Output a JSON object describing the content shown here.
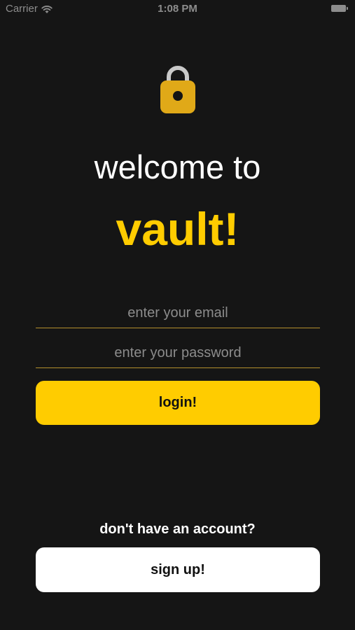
{
  "status_bar": {
    "carrier": "Carrier",
    "time": "1:08 PM",
    "wifi_icon": "wifi-icon",
    "battery_icon": "battery-icon"
  },
  "header": {
    "icon": "lock-icon",
    "welcome": "welcome to",
    "app_name": "vault!"
  },
  "form": {
    "email_placeholder": "enter your email",
    "email_value": "",
    "password_placeholder": "enter your password",
    "password_value": "",
    "login_label": "login!"
  },
  "footer": {
    "prompt": "don't have an account?",
    "signup_label": "sign up!"
  },
  "colors": {
    "background": "#151515",
    "accent": "#ffcc00",
    "field_underline": "#b3902d",
    "placeholder": "#8c8c8c",
    "button_secondary": "#ffffff"
  }
}
